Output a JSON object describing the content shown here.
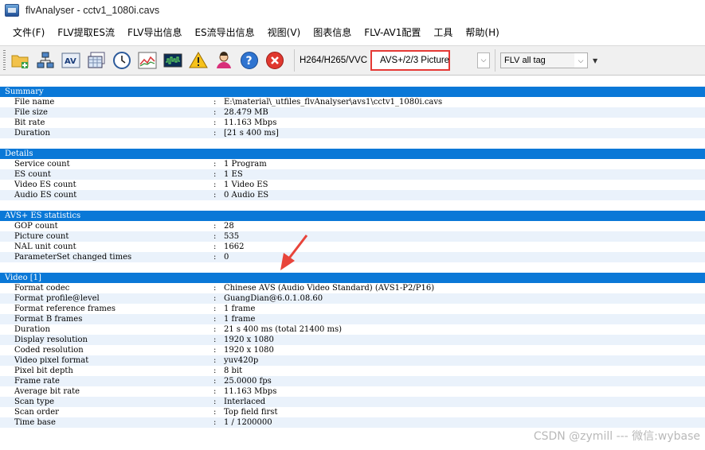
{
  "window": {
    "title": "flvAnalyser - cctv1_1080i.cavs"
  },
  "menu": [
    "文件(F)",
    "FLV提取ES流",
    "FLV导出信息",
    "ES流导出信息",
    "视图(V)",
    "图表信息",
    "FLV-AV1配置",
    "工具",
    "帮助(H)"
  ],
  "toolbar": {
    "icons": [
      "open-folder-icon",
      "network-icon",
      "av-icon",
      "grid-windows-icon",
      "clock-icon",
      "line-chart-icon",
      "waveform-icon",
      "warning-icon",
      "user-icon",
      "help-icon",
      "close-icon"
    ],
    "codec_label": "H264/H265/VVC",
    "codec_combo_value": "AVS+/2/3 Picture",
    "tag_combo_value": "FLV all tag"
  },
  "sections": [
    {
      "title": "Summary",
      "rows": [
        {
          "key": "File name",
          "value": "E:\\material\\_utfiles_flvAnalyser\\avs1\\cctv1_1080i.cavs"
        },
        {
          "key": "File size",
          "value": "28.479 MB"
        },
        {
          "key": "Bit rate",
          "value": "11.163 Mbps"
        },
        {
          "key": "Duration",
          "value": "[21 s 400 ms]"
        }
      ]
    },
    {
      "title": "Details",
      "rows": [
        {
          "key": "Service count",
          "value": "1 Program"
        },
        {
          "key": "ES count",
          "value": "1 ES"
        },
        {
          "key": "Video ES count",
          "value": "1 Video ES"
        },
        {
          "key": "Audio ES count",
          "value": "0 Audio ES"
        }
      ]
    },
    {
      "title": "AVS+ ES statistics",
      "rows": [
        {
          "key": "GOP count",
          "value": "28"
        },
        {
          "key": "Picture count",
          "value": "535"
        },
        {
          "key": "NAL unit count",
          "value": "1662"
        },
        {
          "key": "ParameterSet changed times",
          "value": "0"
        }
      ]
    },
    {
      "title": "Video [1]",
      "rows": [
        {
          "key": "Format codec",
          "value": "Chinese AVS (Audio Video Standard) (AVS1-P2/P16)"
        },
        {
          "key": "Format profile@level",
          "value": "GuangDian@6.0.1.08.60"
        },
        {
          "key": "Format reference frames",
          "value": "1 frame"
        },
        {
          "key": "Format B frames",
          "value": "1 frame"
        },
        {
          "key": "Duration",
          "value": "21 s 400 ms (total 21400 ms)"
        },
        {
          "key": "Display resolution",
          "value": "1920 x 1080"
        },
        {
          "key": "Coded resolution",
          "value": "1920 x 1080"
        },
        {
          "key": "Video pixel format",
          "value": "yuv420p"
        },
        {
          "key": "Pixel bit depth",
          "value": "8 bit"
        },
        {
          "key": "Frame rate",
          "value": "25.0000 fps"
        },
        {
          "key": "Average bit rate",
          "value": "11.163 Mbps"
        },
        {
          "key": "Scan type",
          "value": "Interlaced"
        },
        {
          "key": "Scan order",
          "value": "Top field first"
        },
        {
          "key": "Time base",
          "value": "1 / 1200000"
        }
      ]
    }
  ],
  "separator": ":",
  "watermark": "CSDN @zymill --- 微信:wybase",
  "colors": {
    "section_header": "#0a78d7",
    "alt_row": "#eaf2fb",
    "highlight_box": "#e53935"
  }
}
